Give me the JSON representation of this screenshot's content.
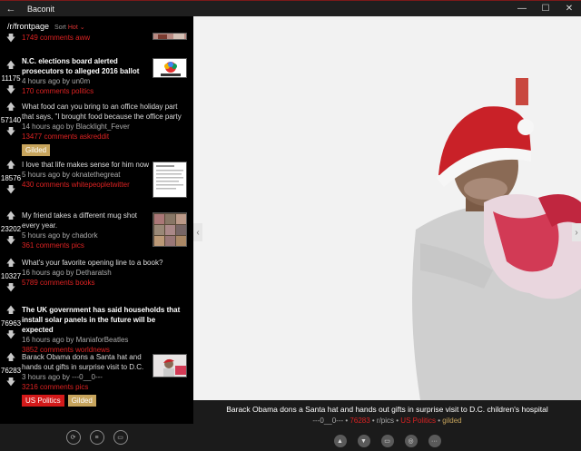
{
  "window": {
    "title": "Baconit",
    "back_icon": "back-arrow-icon",
    "minimize": "—",
    "maximize": "☐",
    "close": "✕"
  },
  "feed": {
    "subreddit": "/r/frontpage",
    "sort_label": "Sort",
    "sort_value": "Hot",
    "partial": {
      "comments": "1749 comments aww"
    },
    "posts": [
      {
        "score": "11175",
        "title": "N.C. elections board alerted prosecutors to alleged 2016 ballot",
        "meta": "4 hours ago by un0m",
        "comments": "170 comments politics",
        "bold": true
      },
      {
        "score": "57140",
        "title": "What food can you bring to an office holiday part that says, \"I brought food because the office party",
        "meta": "14 hours ago by Blacklight_Fever",
        "comments": "13477 comments askreddit",
        "tag": "Gilded"
      },
      {
        "score": "18576",
        "title": "I love that life makes sense for him now",
        "meta": "5 hours ago by oknatethegreat",
        "comments": "430 comments whitepeopletwitter"
      },
      {
        "score": "23202",
        "title": "My friend takes a different mug shot every year.",
        "meta": "5 hours ago by chadork",
        "comments": "361 comments pics"
      },
      {
        "score": "10327",
        "title": "What's your favorite opening line to a book?",
        "meta": "16 hours ago by Detharatsh",
        "comments": "5789 comments books"
      },
      {
        "score": "76963",
        "title": "The UK government has said households that install solar panels in the future will be expected",
        "meta": "16 hours ago by ManiaforBeatles",
        "comments": "3852 comments worldnews",
        "bold": true
      },
      {
        "score": "76283",
        "title": "Barack Obama dons a Santa hat and hands out gifts in surprise visit to D.C.",
        "meta": "3 hours ago by ---0__0---",
        "comments": "3216 comments pics",
        "flair": "US Politics",
        "tag": "Gilded"
      }
    ]
  },
  "left_toolbar": [
    "refresh-icon",
    "menu-icon",
    "window-icon"
  ],
  "viewer": {
    "caption": "Barack Obama dons a Santa hat and hands out gifts in surprise visit to D.C. children's hospital",
    "meta_author": "---0__0---",
    "meta_score": "76283",
    "meta_sub": "r/pics",
    "meta_flair": "US Politics",
    "meta_gilded": "gilded",
    "sep": " • ",
    "actions": [
      "upvote-icon",
      "downvote-icon",
      "comment-icon",
      "globe-icon",
      "more-icon"
    ]
  }
}
